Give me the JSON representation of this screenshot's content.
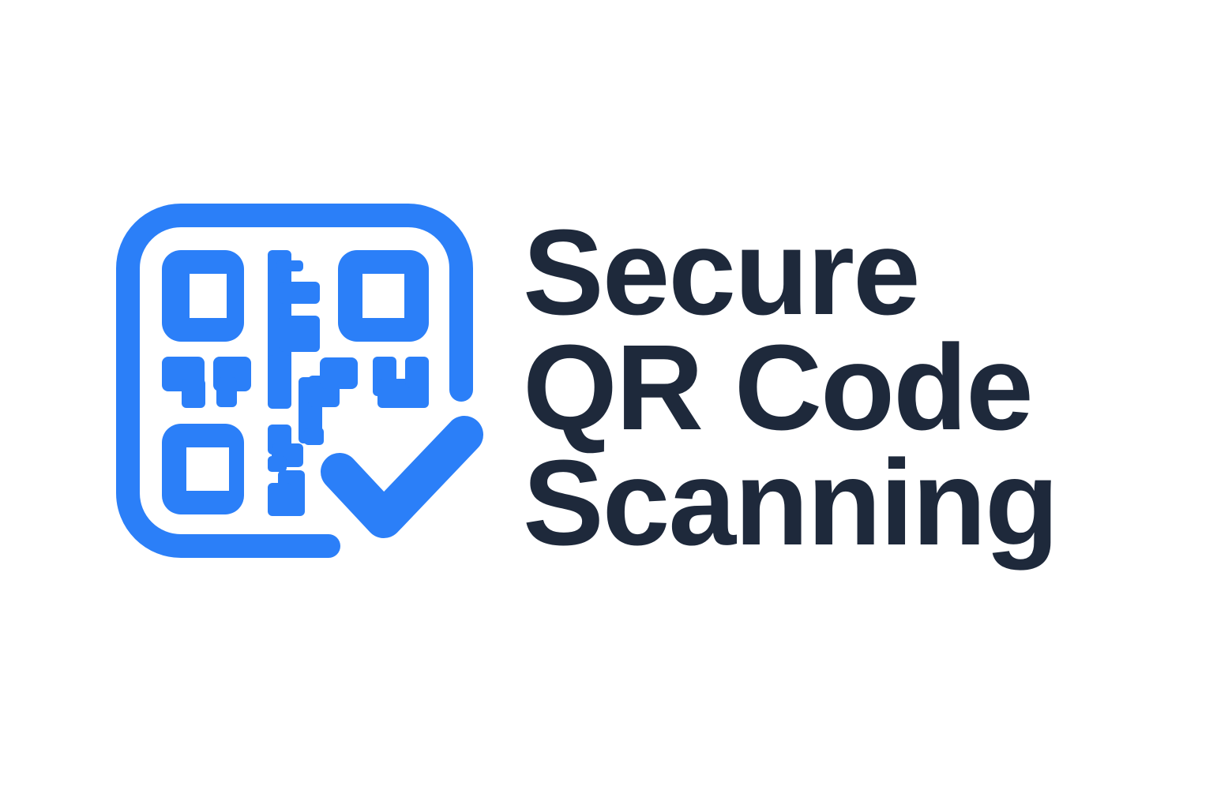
{
  "logo": {
    "icon": "qr-code-check-icon",
    "color": "#2B7FF8"
  },
  "wordmark": {
    "lines": [
      "Secure",
      "QR Code",
      "Scanning"
    ],
    "color": "#1E293B"
  },
  "background": "#FFFFFF"
}
